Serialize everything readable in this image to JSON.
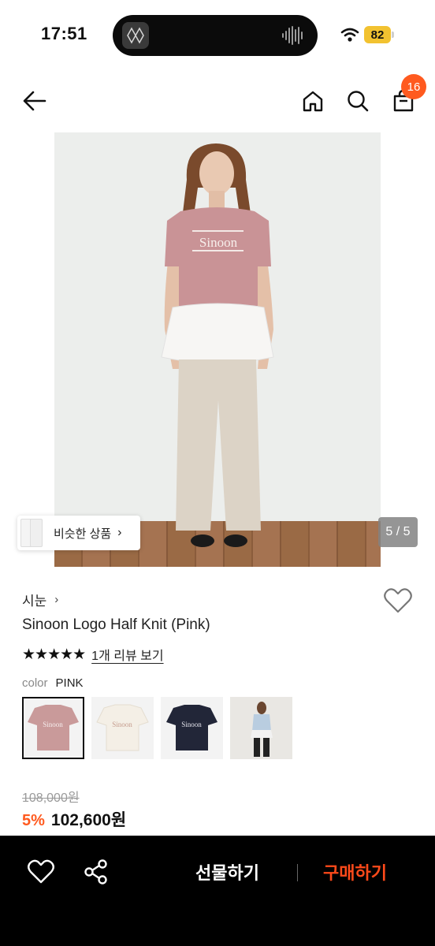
{
  "status_bar": {
    "time": "17:51",
    "battery": "82"
  },
  "nav": {
    "cart_count": "16"
  },
  "image": {
    "similar_label": "비슷한 상품",
    "page_indicator": "5 / 5",
    "shirt_text": "Sinoon"
  },
  "product": {
    "brand": "시눈",
    "name": "Sinoon Logo Half Knit (Pink)",
    "rating": 5,
    "review_link": "1개 리뷰 보기",
    "color_key": "color",
    "color_value": "PINK",
    "swatches": [
      {
        "name": "pink",
        "color": "#c99a9a",
        "text": "Sinoon"
      },
      {
        "name": "cream",
        "color": "#f1ece2",
        "text": "Sinoon"
      },
      {
        "name": "navy",
        "color": "#222638",
        "text": "Sinoon"
      },
      {
        "name": "model-blue",
        "color": "#b9cde0"
      }
    ],
    "original_price": "108,000원",
    "discount": "5%",
    "price": "102,600원"
  },
  "bottom_bar": {
    "gift_label": "선물하기",
    "buy_label": "구매하기"
  },
  "colors": {
    "accent": "#ff5a1f",
    "buy": "#ff4a1a",
    "bar": "#000000"
  }
}
